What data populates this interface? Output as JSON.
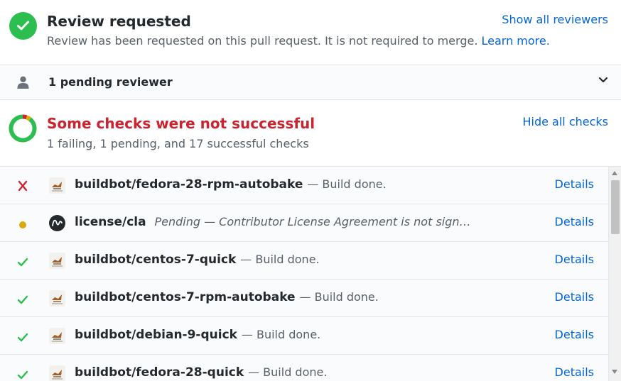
{
  "colors": {
    "success": "#2cbe4e",
    "failure": "#cb2431",
    "pending": "#dbab09",
    "link": "#0366d6"
  },
  "review": {
    "title": "Review requested",
    "description": "Review has been requested on this pull request. It is not required to merge.",
    "learn_more": "Learn more.",
    "show_all": "Show all reviewers",
    "icon": "check-icon"
  },
  "pending": {
    "label": "1 pending reviewer",
    "icon": "person-icon"
  },
  "checks": {
    "title": "Some checks were not successful",
    "summary": "1 failing, 1 pending, and 17 successful checks",
    "hide_all": "Hide all checks",
    "counts": {
      "failing": 1,
      "pending": 1,
      "successful": 17
    }
  },
  "check_rows": [
    {
      "status": "failure",
      "avatar": "buildbot-logo",
      "name": "buildbot/fedora-28-rpm-autobake",
      "message": "— Build done.",
      "details": "Details"
    },
    {
      "status": "pending",
      "avatar": "cla-logo",
      "name": "license/cla",
      "message": "Pending — Contributor License Agreement is not sign…",
      "details": "Details"
    },
    {
      "status": "success",
      "avatar": "buildbot-logo",
      "name": "buildbot/centos-7-quick",
      "message": "— Build done.",
      "details": "Details"
    },
    {
      "status": "success",
      "avatar": "buildbot-logo",
      "name": "buildbot/centos-7-rpm-autobake",
      "message": "— Build done.",
      "details": "Details"
    },
    {
      "status": "success",
      "avatar": "buildbot-logo",
      "name": "buildbot/debian-9-quick",
      "message": "— Build done.",
      "details": "Details"
    },
    {
      "status": "success",
      "avatar": "buildbot-logo",
      "name": "buildbot/fedora-28-quick",
      "message": "— Build done.",
      "details": "Details"
    }
  ]
}
